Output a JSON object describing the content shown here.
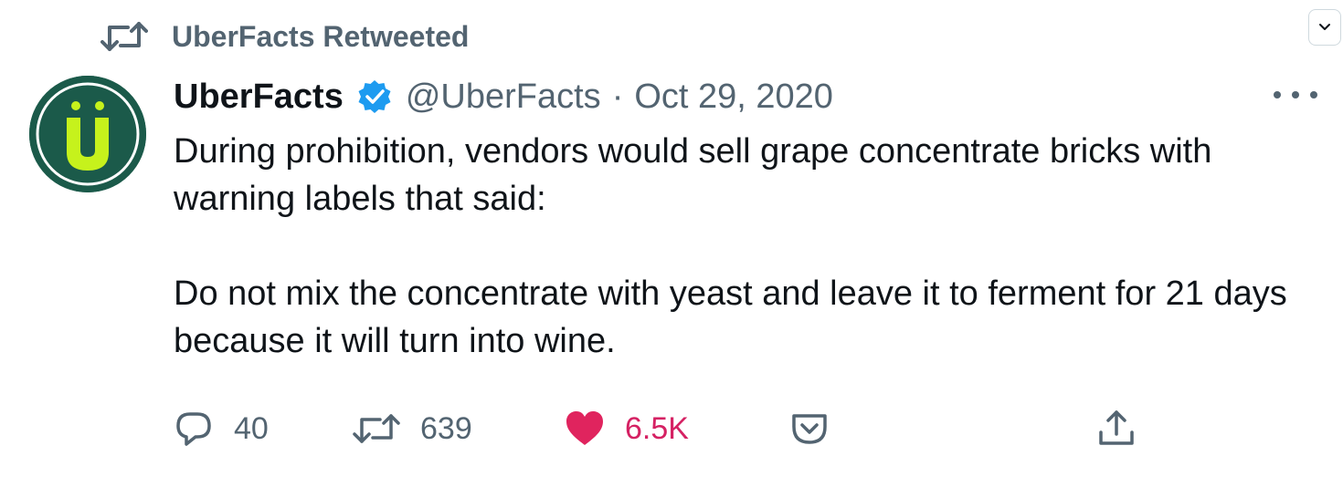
{
  "retweet_banner": {
    "text": "UberFacts Retweeted"
  },
  "author": {
    "name": "UberFacts",
    "handle": "@UberFacts",
    "separator": "·",
    "date": "Oct 29, 2020",
    "avatar_letter": "Ü"
  },
  "tweet": {
    "paragraphs": [
      "During prohibition, vendors would sell grape concentrate bricks with warning labels that said:",
      "Do not mix the concentrate with yeast and leave it to ferment for 21 days because it will turn into wine."
    ]
  },
  "actions": {
    "reply_count": "40",
    "retweet_count": "639",
    "like_count": "6.5K"
  },
  "colors": {
    "text_primary": "#0f1419",
    "text_secondary": "#536471",
    "verified_blue": "#1d9bf0",
    "like_red": "#e0245e",
    "avatar_bg": "#1b5a4a",
    "avatar_accent": "#c6f21c"
  },
  "icons": [
    "retweet-icon",
    "chevron-down-icon",
    "verified-badge-icon",
    "more-icon",
    "reply-icon",
    "heart-icon",
    "pocket-icon",
    "share-icon"
  ]
}
